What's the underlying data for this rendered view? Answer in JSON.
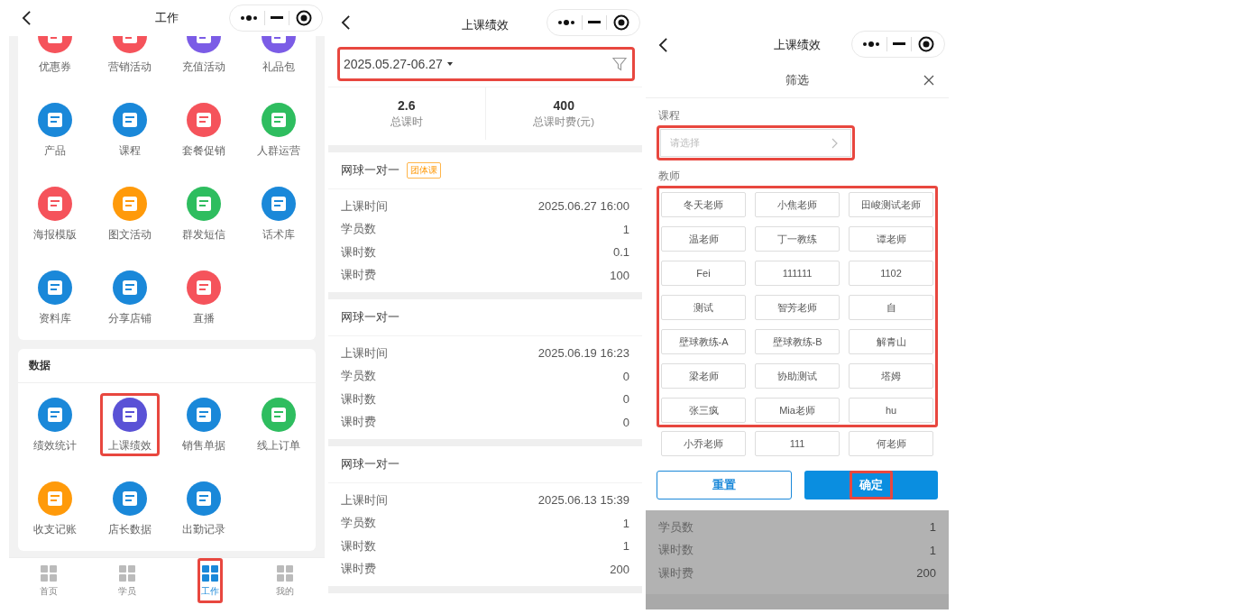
{
  "work_screen": {
    "header": {
      "title": "工作"
    },
    "app_sections": [
      {
        "items": [
          {
            "label": "优惠券",
            "color": "#f5535b"
          },
          {
            "label": "营销活动",
            "color": "#f5535b"
          },
          {
            "label": "充值活动",
            "color": "#7b5ce6"
          },
          {
            "label": "礼品包",
            "color": "#7b5ce6"
          },
          {
            "label": "产品",
            "color": "#1a88d9"
          },
          {
            "label": "课程",
            "color": "#1a88d9"
          },
          {
            "label": "套餐促销",
            "color": "#f5535b"
          },
          {
            "label": "人群运营",
            "color": "#2ebd5f"
          },
          {
            "label": "海报模版",
            "color": "#f5535b"
          },
          {
            "label": "图文活动",
            "color": "#ff9a0a"
          },
          {
            "label": "群发短信",
            "color": "#2ebd5f"
          },
          {
            "label": "话术库",
            "color": "#1a88d9"
          },
          {
            "label": "资料库",
            "color": "#1a88d9"
          },
          {
            "label": "分享店铺",
            "color": "#1a88d9"
          },
          {
            "label": "直播",
            "color": "#f5535b"
          }
        ]
      },
      {
        "title": "数据",
        "items": [
          {
            "label": "绩效统计",
            "color": "#1a88d9"
          },
          {
            "label": "上课绩效",
            "color": "#5a52d6",
            "highlighted": true
          },
          {
            "label": "销售单据",
            "color": "#1a88d9"
          },
          {
            "label": "线上订单",
            "color": "#2ebd5f"
          },
          {
            "label": "收支记账",
            "color": "#ff9a0a"
          },
          {
            "label": "店长数据",
            "color": "#1a88d9"
          },
          {
            "label": "出勤记录",
            "color": "#1a88d9"
          }
        ]
      }
    ],
    "tab_bar": [
      {
        "label": "首页",
        "selected": false
      },
      {
        "label": "学员",
        "selected": false
      },
      {
        "label": "工作",
        "selected": true,
        "highlighted": true
      },
      {
        "label": "我的",
        "selected": false
      }
    ]
  },
  "performance_screen": {
    "header": {
      "title": "上课绩效"
    },
    "date_filter": {
      "value": "2025.05.27-06.27",
      "highlighted": true
    },
    "stats": [
      {
        "value": "2.6",
        "label": "总课时"
      },
      {
        "value": "400",
        "label": "总课时费(元)"
      }
    ],
    "records": [
      {
        "course": "网球一对一",
        "tag": "团体课",
        "rows": [
          {
            "label": "上课时间",
            "value": "2025.06.27 16:00"
          },
          {
            "label": "学员数",
            "value": "1"
          },
          {
            "label": "课时数",
            "value": "0.1"
          },
          {
            "label": "课时费",
            "value": "100"
          }
        ]
      },
      {
        "course": "网球一对一",
        "rows": [
          {
            "label": "上课时间",
            "value": "2025.06.19 16:23"
          },
          {
            "label": "学员数",
            "value": "0"
          },
          {
            "label": "课时数",
            "value": "0"
          },
          {
            "label": "课时费",
            "value": "0"
          }
        ]
      },
      {
        "course": "网球一对一",
        "rows": [
          {
            "label": "上课时间",
            "value": "2025.06.13 15:39"
          },
          {
            "label": "学员数",
            "value": "1"
          },
          {
            "label": "课时数",
            "value": "1"
          },
          {
            "label": "课时费",
            "value": "200"
          }
        ]
      }
    ]
  },
  "filter_screen": {
    "header": {
      "title": "上课绩效"
    },
    "sheet": {
      "title": "筛选",
      "course_label": "课程",
      "course_select": {
        "placeholder": "请选择",
        "highlighted": true
      },
      "teacher_label": "教师",
      "teacher_blocks": [
        {
          "highlighted": true,
          "teachers": [
            {
              "name": "冬天老师",
              "selected": false
            },
            {
              "name": "小焦老师",
              "selected": false
            },
            {
              "name": "田峻测试老师",
              "selected": false
            },
            {
              "name": "温老师",
              "selected": false
            },
            {
              "name": "丁一教练",
              "selected": false
            },
            {
              "name": "谭老师",
              "selected": false
            },
            {
              "name": "Fei",
              "selected": false
            },
            {
              "name": "111111",
              "selected": false
            },
            {
              "name": "1102",
              "selected": false
            },
            {
              "name": "测试",
              "selected": false
            },
            {
              "name": "智芳老师",
              "selected": false
            },
            {
              "name": "自",
              "selected": false
            },
            {
              "name": "壁球教练-A",
              "selected": false
            },
            {
              "name": "壁球教练-B",
              "selected": false
            },
            {
              "name": "解青山",
              "selected": false
            },
            {
              "name": "梁老师",
              "selected": false
            },
            {
              "name": "协助测试",
              "selected": false
            },
            {
              "name": "塔姆",
              "selected": false
            },
            {
              "name": "张三疯",
              "selected": false
            },
            {
              "name": "Mia老师",
              "selected": false
            },
            {
              "name": "hu",
              "selected": false
            }
          ]
        },
        {
          "highlighted": false,
          "teachers": [
            {
              "name": "小乔老师",
              "selected": false
            },
            {
              "name": "111",
              "selected": false
            },
            {
              "name": "何老师",
              "selected": false
            }
          ]
        }
      ],
      "reset": "重置",
      "confirm": {
        "label": "确定",
        "highlighted": true
      }
    },
    "background_rows": [
      {
        "label": "学员数",
        "value": "1"
      },
      {
        "label": "课时数",
        "value": "1"
      },
      {
        "label": "课时费",
        "value": "200"
      }
    ]
  }
}
